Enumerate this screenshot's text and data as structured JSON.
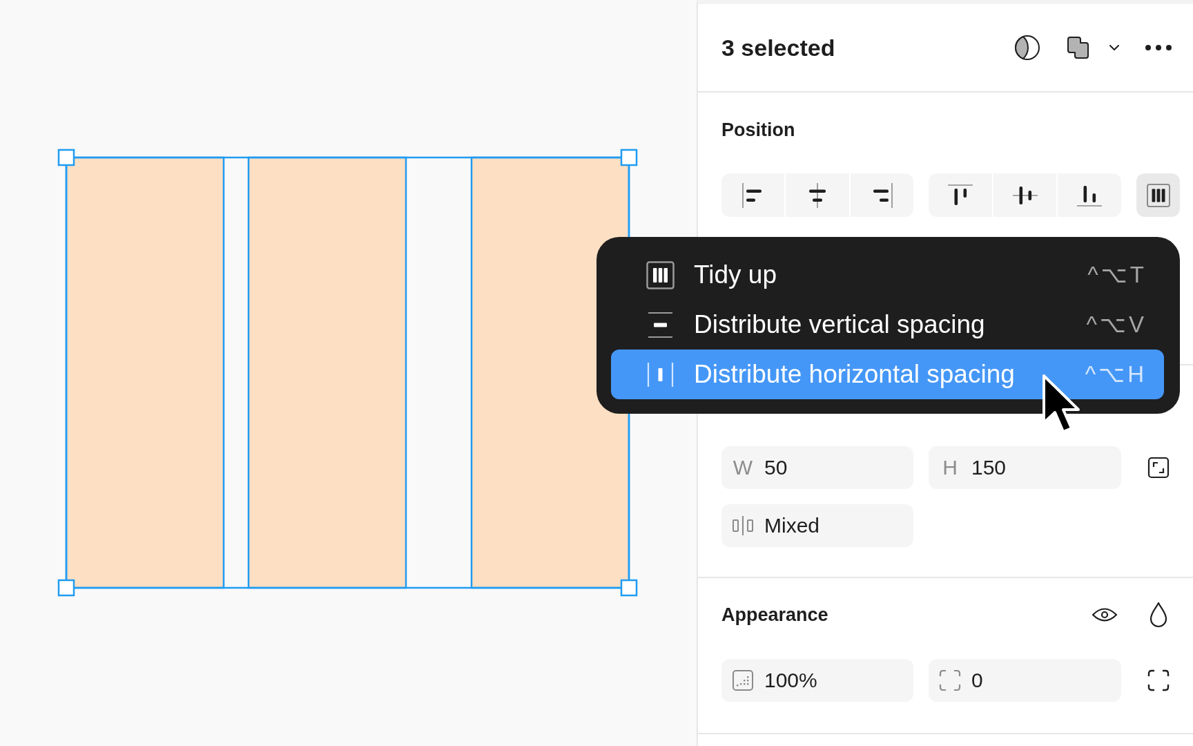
{
  "canvas": {
    "shapes": [
      {
        "selected": true
      },
      {
        "selected": true
      },
      {
        "selected": true
      }
    ]
  },
  "panel": {
    "title": "3 selected",
    "position": {
      "title": "Position",
      "tidy_button": {
        "expanded": true
      }
    },
    "size_fields": [
      {
        "label": "W",
        "value": "50"
      },
      {
        "label": "H",
        "value": "150"
      }
    ],
    "spacing_field": {
      "value": "Mixed"
    },
    "appearance": {
      "title": "Appearance",
      "fields": [
        {
          "kind": "opacity",
          "value": "100%"
        },
        {
          "kind": "radius",
          "value": "0"
        }
      ]
    }
  },
  "menu": {
    "items": [
      {
        "label": "Tidy up",
        "shortcut": "^⌥T",
        "selected": false
      },
      {
        "label": "Distribute vertical spacing",
        "shortcut": "^⌥V",
        "selected": false
      },
      {
        "label": "Distribute horizontal spacing",
        "shortcut": "^⌥H",
        "selected": true
      }
    ]
  }
}
